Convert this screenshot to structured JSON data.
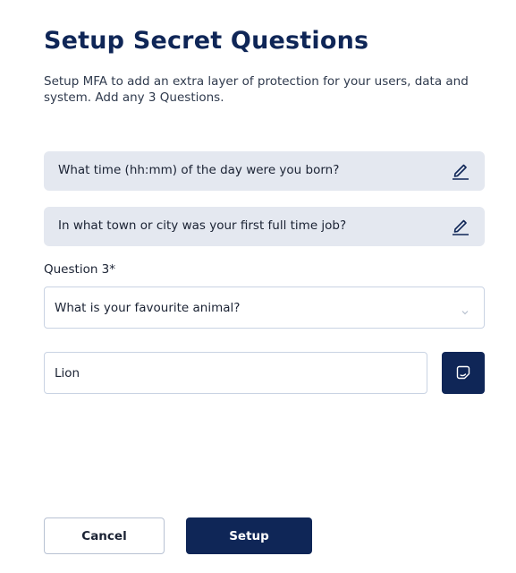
{
  "header": {
    "title": "Setup Secret Questions",
    "subtitle": "Setup MFA to add an extra layer of protection for your users, data and system. Add any 3 Questions."
  },
  "questions": [
    {
      "text": "What time (hh:mm) of the day were you born?",
      "icon": "pencil-icon"
    },
    {
      "text": "In what town or city was your first full time job?",
      "icon": "pencil-icon"
    }
  ],
  "question3": {
    "label": "Question 3*",
    "selected": "What is your favourite animal?",
    "answer": "Lion",
    "save_icon": "save-icon"
  },
  "actions": {
    "cancel_label": "Cancel",
    "setup_label": "Setup"
  },
  "colors": {
    "primary": "#0f2657",
    "card_bg": "#e4e8f0",
    "border": "#c9d3e3"
  }
}
